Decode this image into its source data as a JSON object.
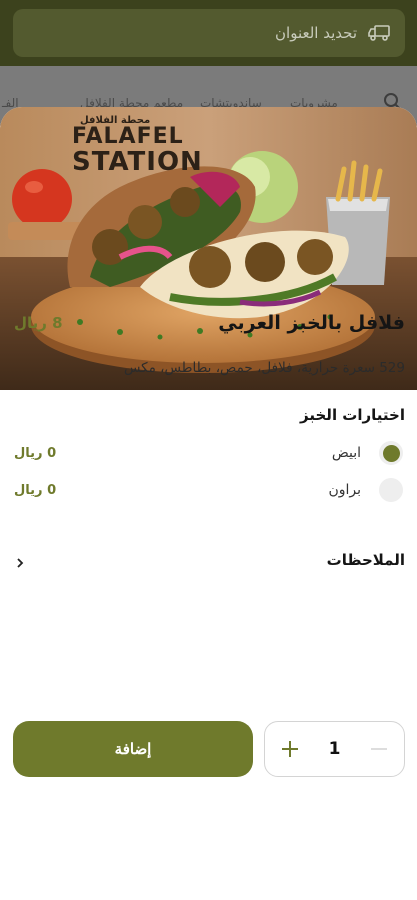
{
  "background": {
    "address_label": "تحديد العنوان",
    "tabs": [
      "الفـ",
      "مطعم محطة الفلافل",
      "ساندويتشات",
      "مشروبات"
    ]
  },
  "item": {
    "logo": {
      "arabic": "محطة الفلافل",
      "line1": "FALAFEL",
      "line2": "STATION"
    },
    "title": "فلافل بالخبز العربي",
    "price": "8 ريال",
    "description": "529 سعرة حرارية، فلافل، حمص، بطاطس، مكس"
  },
  "options": {
    "heading": "اختيارات الخبز",
    "choices": [
      {
        "label": "ابيض",
        "price": "0 ريال",
        "selected": true
      },
      {
        "label": "براون",
        "price": "0 ريال",
        "selected": false
      }
    ]
  },
  "notes": {
    "label": "الملاحظات"
  },
  "footer": {
    "add_label": "إضافة",
    "quantity": "1"
  },
  "colors": {
    "accent": "#6f7a2c",
    "header": "#3c421d"
  },
  "icons": {
    "truck": "truck-icon",
    "search": "search-icon",
    "chevron": "chevron-right-icon",
    "plus": "plus-icon",
    "minus": "minus-icon"
  }
}
